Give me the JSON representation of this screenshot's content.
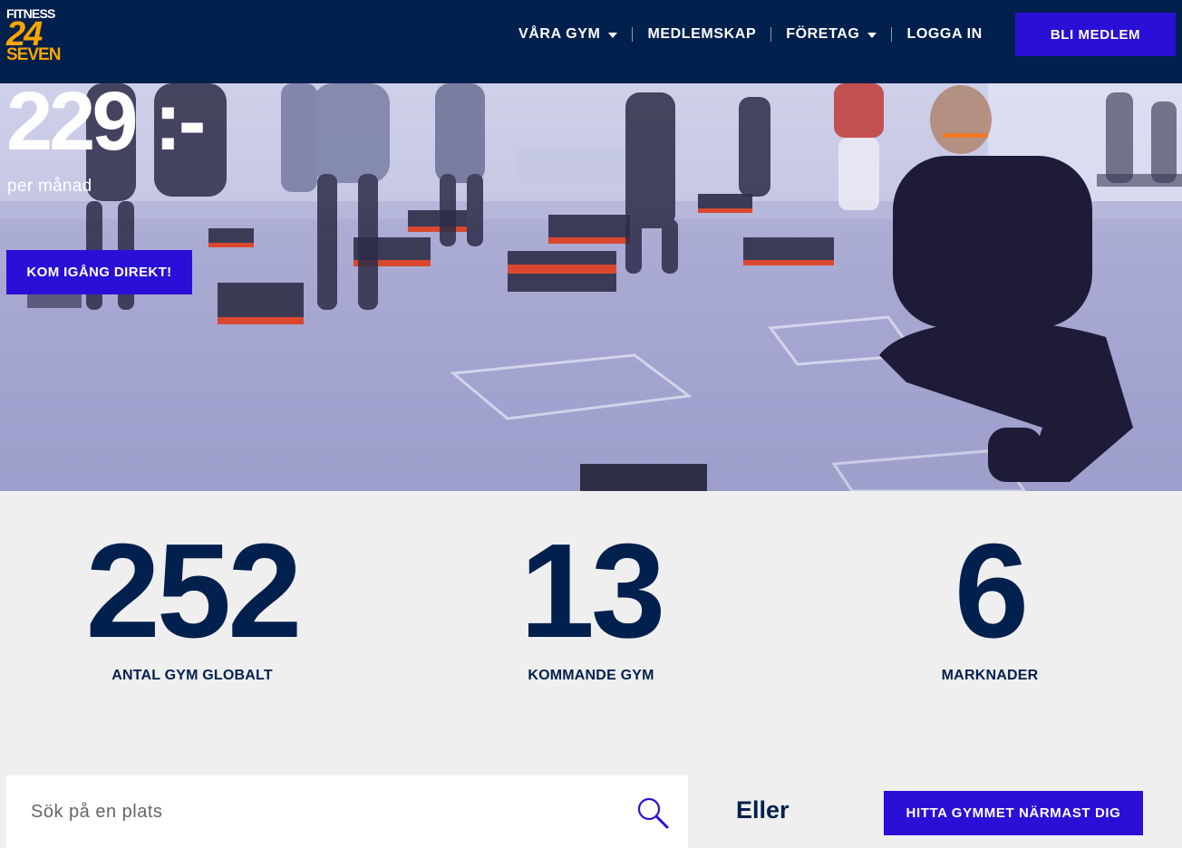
{
  "brand": {
    "line1": "FITNESS",
    "line2": "24",
    "line3": "SEVEN"
  },
  "nav": {
    "items": [
      {
        "label": "VÅRA GYM",
        "dropdown": true
      },
      {
        "label": "MEDLEMSKAP",
        "dropdown": false
      },
      {
        "label": "FÖRETAG",
        "dropdown": true
      },
      {
        "label": "LOGGA IN",
        "dropdown": false
      }
    ],
    "cta_label": "BLI MEDLEM"
  },
  "hero": {
    "price": "229 :-",
    "period": "per månad",
    "button_label": "KOM IGÅNG DIREKT!"
  },
  "stats": [
    {
      "value": "252",
      "label": "ANTAL GYM GLOBALT"
    },
    {
      "value": "13",
      "label": "KOMMANDE GYM"
    },
    {
      "value": "6",
      "label": "MARKNADER"
    }
  ],
  "search": {
    "placeholder": "Sök på en plats",
    "value": "",
    "or_label": "Eller",
    "nearest_button_label": "HITTA GYMMET NÄRMAST DIG"
  },
  "colors": {
    "navy": "#02204d",
    "accent_blue": "#2a0fd6",
    "brand_yellow": "#f7a600",
    "page_bg": "#efeff0"
  },
  "icons": [
    "chevron-down-icon",
    "search-icon"
  ]
}
